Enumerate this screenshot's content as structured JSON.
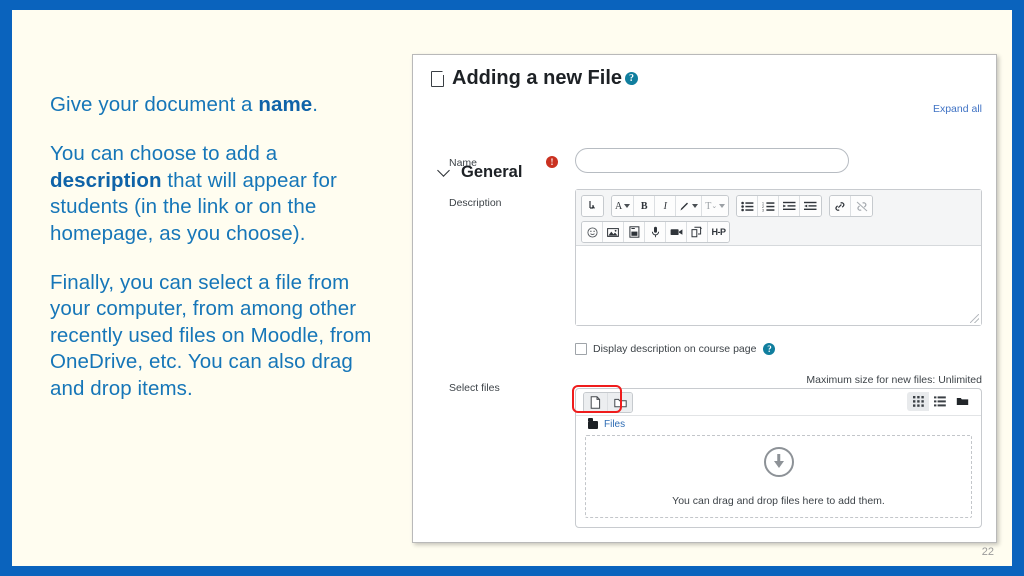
{
  "slide": {
    "background_color": "#fffdf0",
    "border_color": "#0a63bd",
    "page_number": "22"
  },
  "narrative": {
    "p1_before": "Give your document a ",
    "p1_bold": "name",
    "p1_after": ".",
    "p2_before": "You can choose to add a ",
    "p2_bold": "description",
    "p2_after": " that will appear for students (in the link or on the homepage, as you choose).",
    "p3": "Finally, you can select a file from your computer, from among other recently used files on Moodle, from OneDrive, etc. You can also drag and drop items."
  },
  "screenshot": {
    "title": "Adding a new File",
    "title_icon": "document-icon",
    "title_help": "?",
    "expand_all": "Expand all",
    "section": {
      "label": "General",
      "collapse_icon": "chevron-down-icon"
    },
    "fields": {
      "name_label": "Name",
      "name_required_mark": "!",
      "name_value": "",
      "name_placeholder": "",
      "description_label": "Description",
      "description_value": "",
      "select_files_label": "Select files"
    },
    "editor_toolbar": {
      "row1": [
        {
          "name": "undo-redo-icon",
          "glyph": "↵"
        },
        {
          "name": "font-style-icon",
          "glyph": "A",
          "caret": true
        },
        {
          "name": "bold-icon",
          "glyph": "B"
        },
        {
          "name": "italic-icon",
          "glyph": "I"
        },
        {
          "name": "highlight-color-icon",
          "glyph": "✒",
          "caret": true
        },
        {
          "name": "text-format-icon",
          "glyph": "T",
          "caret": true
        },
        {
          "name": "bulleted-list-icon",
          "glyph": "list"
        },
        {
          "name": "numbered-list-icon",
          "glyph": "numlist"
        },
        {
          "name": "indent-icon",
          "glyph": "indent"
        },
        {
          "name": "outdent-icon",
          "glyph": "outdent"
        },
        {
          "name": "link-icon",
          "glyph": "link"
        },
        {
          "name": "unlink-icon",
          "glyph": "unlink"
        }
      ],
      "row2": [
        {
          "name": "emoji-icon",
          "glyph": "☺"
        },
        {
          "name": "insert-image-icon",
          "glyph": "image"
        },
        {
          "name": "insert-file-icon",
          "glyph": "file"
        },
        {
          "name": "record-audio-icon",
          "glyph": "mic"
        },
        {
          "name": "record-video-icon",
          "glyph": "video"
        },
        {
          "name": "manage-files-icon",
          "glyph": "copy"
        },
        {
          "name": "h5p-icon",
          "glyph": "H-P"
        }
      ]
    },
    "checkbox": {
      "label": "Display description on course page",
      "checked": false,
      "help": "?"
    },
    "filepicker": {
      "max_size_note": "Maximum size for new files: Unlimited",
      "add_file_button": "add-file-icon",
      "create_folder_button": "create-folder-icon",
      "view_icons_button": "grid-view-icon",
      "view_list_button": "list-view-icon",
      "view_tree_button": "tree-view-icon",
      "breadcrumb": "Files",
      "dropzone_text": "You can drag and drop files here to add them.",
      "dropzone_icon": "download-arrow-icon",
      "highlight_color": "#ef1c1c"
    }
  }
}
